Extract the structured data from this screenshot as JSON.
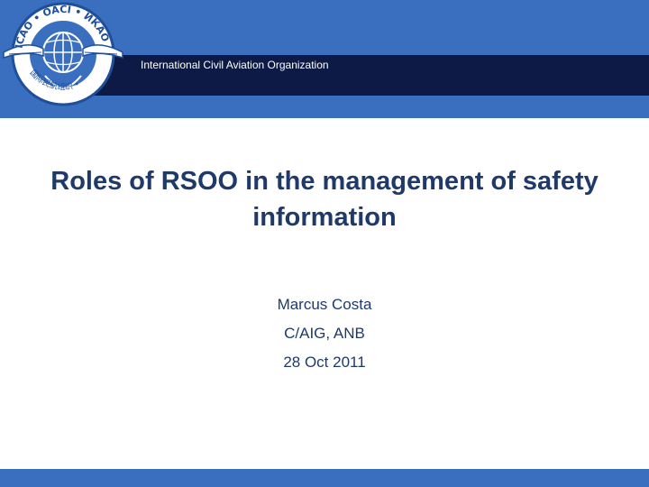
{
  "header": {
    "logo_text": "ICAO • OACI • ИКАО • 国际民航组织 •",
    "organization": "International Civil Aviation Organization"
  },
  "slide": {
    "title": "Roles of RSOO in the management of safety information",
    "presenter_name": "Marcus Costa",
    "presenter_unit": "C/AIG, ANB",
    "date": "28 Oct 2011"
  },
  "colors": {
    "band_blue": "#3a6fc0",
    "navy": "#0c1a45",
    "title_blue": "#1f3a6a"
  }
}
